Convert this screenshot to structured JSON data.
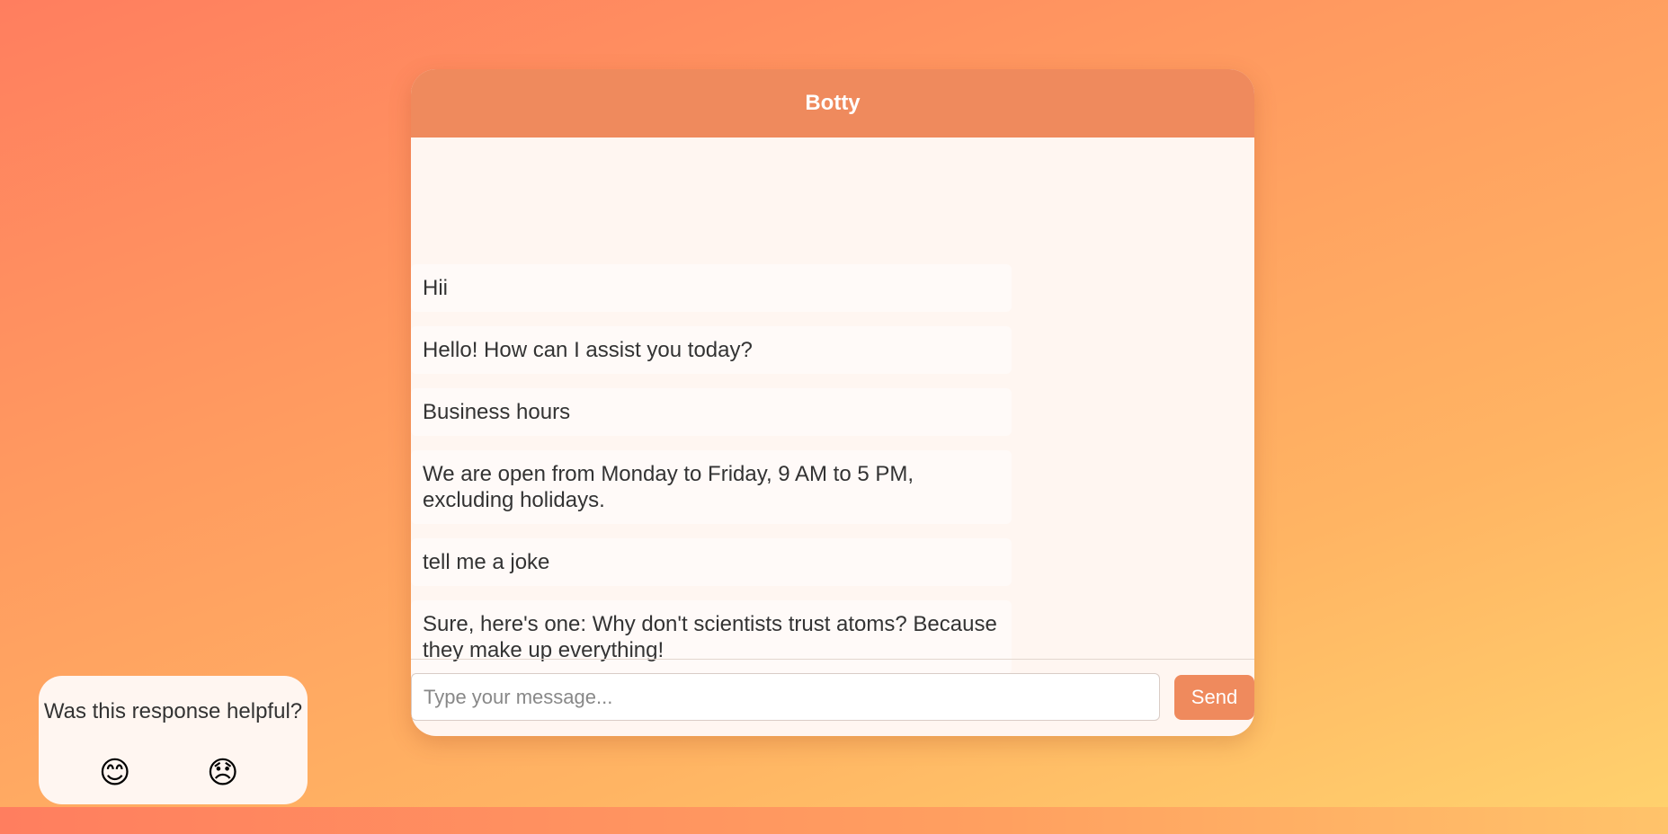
{
  "chat": {
    "title": "Botty",
    "messages": [
      {
        "text": "Hii"
      },
      {
        "text": "Hello! How can I assist you today?"
      },
      {
        "text": "Business hours"
      },
      {
        "text": "We are open from Monday to Friday, 9 AM to 5 PM, excluding holidays."
      },
      {
        "text": "tell me a joke"
      },
      {
        "text": "Sure, here's one: Why don't scientists trust atoms? Because they make up everything!"
      }
    ],
    "input": {
      "value": "",
      "placeholder": "Type your message..."
    },
    "send_label": "Send"
  },
  "feedback": {
    "question": "Was this response helpful?",
    "positive_icon": "😊",
    "negative_icon": "😞"
  },
  "colors": {
    "accent": "#ef8a5d",
    "background_start": "#ff7e5f",
    "background_end": "#ffd36e"
  }
}
